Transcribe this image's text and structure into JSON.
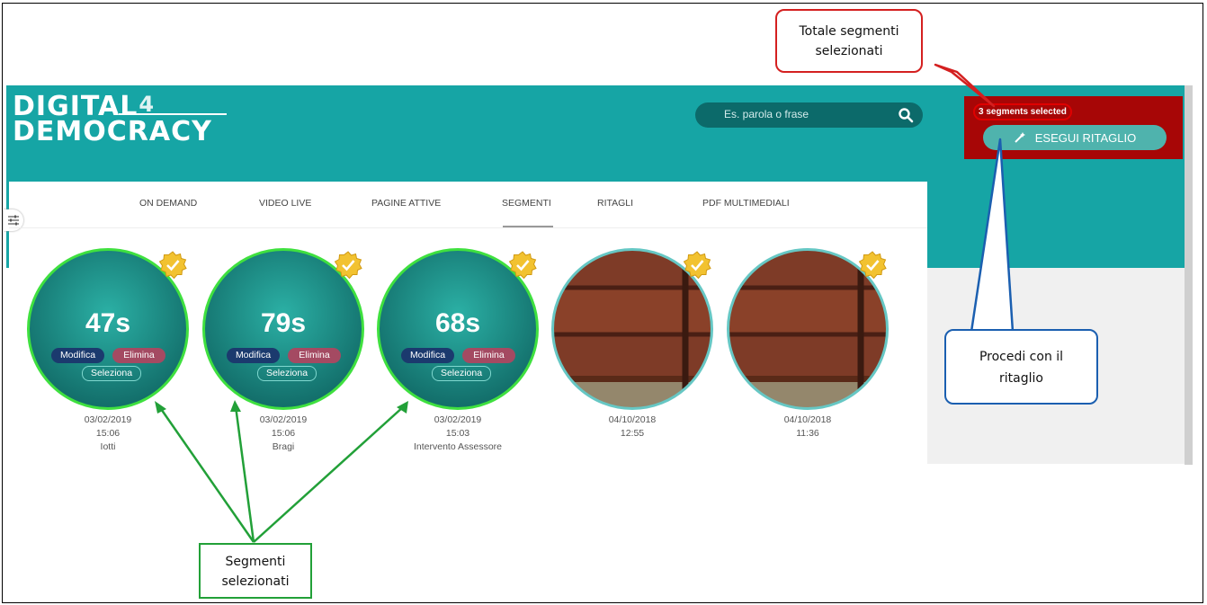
{
  "logo": {
    "line1": "DIGITAL",
    "four": "4",
    "line2": "DEMOCRACY"
  },
  "search": {
    "placeholder": "Es. parola o frase",
    "icon": "search-icon"
  },
  "selection": {
    "count_text": "3 segments selected",
    "execute_label": "ESEGUI RITAGLIO",
    "execute_icon": "magic-wand-icon"
  },
  "tabs": [
    "ON DEMAND",
    "VIDEO LIVE",
    "PAGINE ATTIVE",
    "SEGMENTI",
    "RITAGLI",
    "PDF MULTIMEDIALI"
  ],
  "active_tab": "SEGMENTI",
  "actions": {
    "edit": "Modifica",
    "delete": "Elimina",
    "select": "Seleziona"
  },
  "segments": [
    {
      "duration": "47s",
      "date": "03/02/2019",
      "time": "15:06",
      "title": "Iotti",
      "selected": true
    },
    {
      "duration": "79s",
      "date": "03/02/2019",
      "time": "15:06",
      "title": "Bragi",
      "selected": true
    },
    {
      "duration": "68s",
      "date": "03/02/2019",
      "time": "15:03",
      "title": "Intervento Assessore",
      "selected": true
    },
    {
      "duration": "",
      "date": "04/10/2018",
      "time": "12:55",
      "title": "",
      "selected": false
    },
    {
      "duration": "",
      "date": "04/10/2018",
      "time": "11:36",
      "title": "",
      "selected": false
    }
  ],
  "callouts": {
    "total": [
      "Totale segmenti",
      "selezionati"
    ],
    "proceed": [
      "Procedi con il",
      "ritaglio"
    ],
    "selected": [
      "Segmenti",
      "selezionati"
    ]
  },
  "colors": {
    "header": "#16a5a5",
    "selection_panel": "#a70606",
    "selected_ring": "#3fe03f",
    "callout_red": "#d42020",
    "callout_blue": "#1b5fb0",
    "callout_green": "#22a038"
  }
}
